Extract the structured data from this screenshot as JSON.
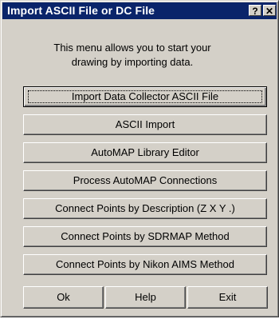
{
  "window": {
    "title": "Import ASCII File or DC File",
    "help_glyph": "?",
    "close_glyph": "✕"
  },
  "description": {
    "line1": "This menu allows you to start your",
    "line2": "drawing by importing data."
  },
  "buttons": [
    "Import Data Collector ASCII File",
    "ASCII Import",
    "AutoMAP Library Editor",
    "Process AutoMAP Connections",
    "Connect Points by Description (Z X Y .)",
    "Connect Points by SDRMAP Method",
    "Connect Points by Nikon AIMS Method"
  ],
  "actions": {
    "ok": "Ok",
    "help": "Help",
    "exit": "Exit"
  },
  "colors": {
    "titlebar": "#0a246a",
    "face": "#d4d0c8"
  }
}
